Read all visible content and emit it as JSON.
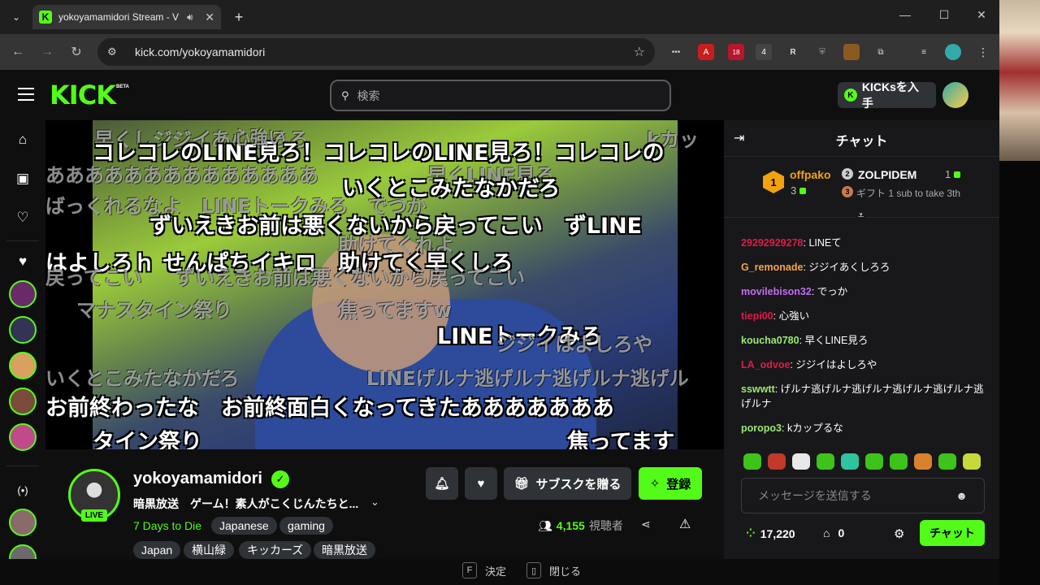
{
  "browser": {
    "tab_title": "yokoyamamidori Stream - V",
    "url": "kick.com/yokoyamamidori",
    "ext_badge_1": "18",
    "ext_badge_2": "4"
  },
  "header": {
    "logo": "KICK",
    "beta": "BETA",
    "search_placeholder": "検索",
    "kicks_button": "KICKsを入手"
  },
  "video": {
    "overlay_comments": [
      "コレコレのLINE見ろ！コレコレのLINE見ろ！コレコレの",
      "いくとこみたなかだろ",
      "ずいえきお前は悪くないから戻ってこい　ずLINE",
      "はよしろｈ せんぱちイキロ　助けてく早くしろ",
      "ああああああああああああああ",
      "マナスタイン祭り",
      "焦ってますw",
      "LINEトークみろ",
      "ジジイはよしろや",
      "いくとこみたなかだろ",
      "LINEげルナ逃げルナ逃げルナ逃げル",
      "お前終わったな　お前終面白くなってきたあああああああ",
      "タイン祭り",
      "焦ってます",
      "ばっくれるなよ　LINEトークみろ　でつか",
      "早くしジジイあくしろろ",
      "ずいえきお前は悪くないから戻ってこい",
      "早くLINE見ろ",
      "心強い",
      "kカッ",
      "助けてくれよ",
      "戻ってこい"
    ]
  },
  "stream": {
    "streamer_name": "yokoyamamidori",
    "live_label": "LIVE",
    "title": "暗黒放送　ゲーム！素人がこくじんたちと...",
    "category": "7 Days to Die",
    "tags": [
      "Japanese",
      "gaming",
      "Japan",
      "横山緑",
      "キッカーズ",
      "暗黒放送"
    ],
    "gift_sub_button": "サブスクを贈る",
    "subscribe_button": "登録",
    "viewer_count": "4,155",
    "viewer_label": "視聴者"
  },
  "chat": {
    "title": "チャット",
    "leaderboard": {
      "first_name": "offpako",
      "first_count": "3",
      "first_rank": "1",
      "second_rank": "2",
      "second_name": "ZOLPIDEM",
      "second_count": "1",
      "third_rank": "3",
      "gift_text": "ギフト 1 sub to take 3th"
    },
    "messages": [
      {
        "user": "2929292927​8",
        "color": "#e0194a",
        "text": "LINEて"
      },
      {
        "user": "G_remonade",
        "color": "#f5a34a",
        "text": "ジジイあくしろろ"
      },
      {
        "user": "movilebison32",
        "color": "#c46df0",
        "text": "でっか"
      },
      {
        "user": "tiepi00",
        "color": "#e0194a",
        "text": "心強い"
      },
      {
        "user": "koucha0780",
        "color": "#9be86f",
        "text": "早くLINE見ろ"
      },
      {
        "user": "LA_odvoe",
        "color": "#e0194a",
        "text": "ジジイはよしろや"
      },
      {
        "user": "sswwtt",
        "color": "#9be86f",
        "text": "げルナ逃げルナ逃げルナ逃げルナ逃げルナ逃げルナ"
      },
      {
        "user": "poropo3",
        "color": "#9be86f",
        "text": "kカップるな"
      }
    ],
    "input_placeholder": "メッセージを送信する",
    "kicks_count": "17,220",
    "chest_count": "0",
    "send_button": "チャット"
  },
  "bottom_hints": {
    "key1": "F",
    "label1": "決定",
    "label2": "閉じる"
  },
  "colors": {
    "accent": "#53fc18",
    "background": "#0f0f10",
    "chat_bg": "#18181b"
  }
}
